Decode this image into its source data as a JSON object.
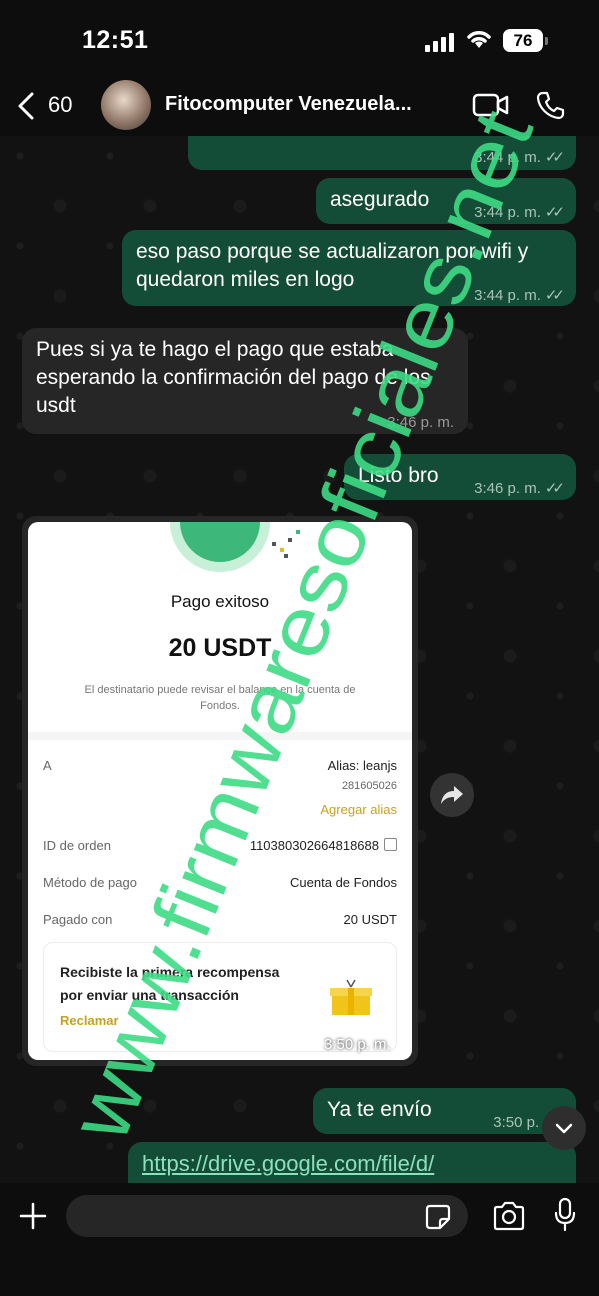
{
  "status": {
    "time": "12:51",
    "battery": "76"
  },
  "header": {
    "back_count": "60",
    "contact_name": "Fitocomputer Venezuela..."
  },
  "messages": [
    {
      "text": "",
      "time": "3:44 p. m."
    },
    {
      "text": "asegurado",
      "time": "3:44 p. m."
    },
    {
      "text": "eso paso porque se actualizaron por wifi y quedaron miles en logo",
      "time": "3:44 p. m."
    },
    {
      "text": "Pues si ya te hago el pago que estaba esperando la confirmación del pago de los usdt",
      "time": "3:46 p. m."
    },
    {
      "text": "Listo bro",
      "time": "3:46 p. m."
    },
    {
      "text": "Ya te envío",
      "time": "3:50 p. m."
    },
    {
      "text": "https://drive.google.com/file/d/",
      "time": ""
    }
  ],
  "payment_card": {
    "title": "Pago exitoso",
    "amount": "20 USDT",
    "description": "El destinatario puede revisar el balance en la cuenta de Fondos.",
    "to_label": "A",
    "alias": "Alias: leanjs",
    "alias_id": "281605026",
    "add_alias": "Agregar alias",
    "order_label": "ID de orden",
    "order_id": "110380302664818688",
    "method_label": "Método de pago",
    "method_value": "Cuenta de Fondos",
    "paid_label": "Pagado con",
    "paid_value": "20 USDT",
    "promo_text": "Recibiste la primera recompensa por enviar una transacción",
    "promo_link": "Reclamar",
    "time": "3:50 p. m."
  },
  "watermark": "www.firmwaresoficiales.net",
  "colors": {
    "outgoing": "#144d37",
    "incoming": "#262626",
    "watermark": "#3ddc84"
  }
}
